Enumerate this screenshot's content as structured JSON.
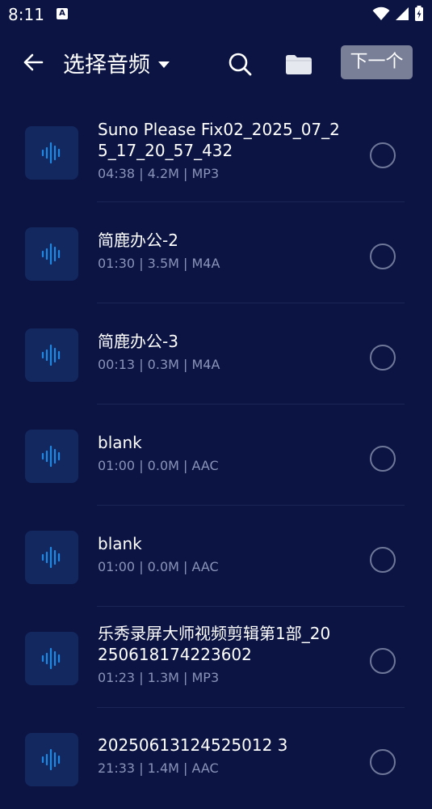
{
  "status_bar": {
    "time": "8:11",
    "notification_icon_label": "A"
  },
  "toolbar": {
    "title": "选择音频",
    "next_label": "下一个"
  },
  "items": [
    {
      "name": "Suno Please Fix02_2025_07_25_17_20_57_432",
      "meta": "04:38 | 4.2M | MP3"
    },
    {
      "name": "简鹿办公-2",
      "meta": "01:30 | 3.5M | M4A"
    },
    {
      "name": "简鹿办公-3",
      "meta": "00:13 | 0.3M | M4A"
    },
    {
      "name": "blank",
      "meta": "01:00 | 0.0M | AAC"
    },
    {
      "name": "blank",
      "meta": "01:00 | 0.0M | AAC"
    },
    {
      "name": "乐秀录屏大师视频剪辑第1部_20250618174223602",
      "meta": "01:23 | 1.3M | MP3"
    },
    {
      "name": "20250613124525012 3",
      "meta": "21:33 | 1.4M | AAC"
    }
  ],
  "colors": {
    "background": "#0b1442",
    "accent": "#1e88e5",
    "button_bg": "#7a7f98"
  }
}
